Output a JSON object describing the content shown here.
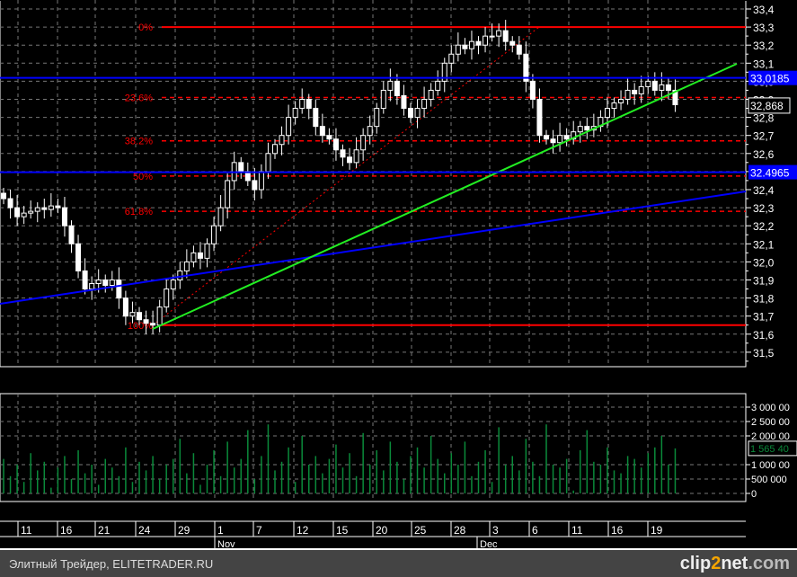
{
  "chart_data": {
    "type": "candlestick",
    "price_axis": {
      "min": 31.5,
      "max": 33.4,
      "ticks": [
        "33,4",
        "33,3",
        "33,2",
        "33,1",
        "33,0",
        "32,9",
        "32,8",
        "32,7",
        "32,6",
        "32,5",
        "32,4",
        "32,3",
        "32,2",
        "32,1",
        "32,0",
        "31,9",
        "31,8",
        "31,7",
        "31,6",
        "31,5"
      ],
      "tick_values": [
        33.4,
        33.3,
        33.2,
        33.1,
        33.0,
        32.9,
        32.8,
        32.7,
        32.6,
        32.5,
        32.4,
        32.3,
        32.2,
        32.1,
        32.0,
        31.9,
        31.8,
        31.7,
        31.6,
        31.5
      ]
    },
    "closes": [
      32.35,
      32.3,
      32.25,
      32.27,
      32.28,
      32.3,
      32.29,
      32.31,
      32.3,
      32.2,
      32.1,
      31.95,
      31.85,
      31.88,
      31.9,
      31.87,
      31.9,
      31.8,
      31.7,
      31.72,
      31.68,
      31.66,
      31.65,
      31.75,
      31.85,
      31.9,
      31.95,
      32.0,
      32.05,
      32.02,
      32.1,
      32.2,
      32.3,
      32.45,
      32.55,
      32.5,
      32.45,
      32.4,
      32.5,
      32.6,
      32.65,
      32.7,
      32.8,
      32.85,
      32.9,
      32.85,
      32.75,
      32.7,
      32.68,
      32.62,
      32.58,
      32.55,
      32.62,
      32.7,
      32.75,
      32.85,
      32.95,
      33.0,
      32.92,
      32.85,
      32.8,
      32.85,
      32.9,
      32.95,
      33.0,
      33.1,
      33.15,
      33.2,
      33.18,
      33.22,
      33.2,
      33.25,
      33.25,
      33.28,
      33.22,
      33.2,
      33.15,
      33.0,
      32.9,
      32.7,
      32.68,
      32.66,
      32.7,
      32.68,
      32.72,
      32.75,
      32.73,
      32.75,
      32.8,
      32.85,
      32.88,
      32.9,
      32.95,
      32.93,
      32.97,
      33.0,
      32.95,
      32.98,
      32.95,
      32.87
    ],
    "volumes": [
      1.2,
      0.6,
      1.0,
      0.4,
      1.4,
      0.8,
      1.1,
      0.2,
      0.9,
      1.3,
      0.5,
      1.5,
      0.7,
      1.0,
      0.3,
      1.2,
      0.9,
      0.6,
      1.6,
      0.4,
      1.1,
      0.8,
      1.3,
      0.5,
      1.0,
      1.2,
      1.9,
      0.7,
      1.4,
      0.3,
      1.0,
      1.5,
      0.6,
      1.8,
      0.9,
      1.2,
      2.2,
      0.5,
      1.3,
      2.4,
      0.8,
      1.1,
      1.6,
      0.4,
      2.0,
      1.0,
      1.3,
      0.7,
      1.2,
      1.7,
      0.9,
      1.4,
      0.6,
      2.1,
      1.0,
      1.5,
      0.8,
      1.8,
      1.1,
      0.5,
      1.3,
      1.6,
      0.9,
      2.0,
      1.2,
      0.7,
      1.4,
      1.0,
      1.8,
      0.6,
      1.1,
      1.5,
      0.4,
      2.3,
      1.0,
      1.3,
      0.8,
      1.9,
      1.1,
      0.6,
      2.4,
      1.0,
      0.9,
      1.2,
      0.1,
      1.5,
      2.2,
      1.1,
      1.0,
      1.6,
      0.8,
      0.7,
      1.3,
      1.2,
      0.9,
      1.4,
      1.6,
      2.0,
      1.0,
      1.565
    ],
    "volume_axis": {
      "min": 0,
      "max": 3000000,
      "ticks": [
        "3 000 00",
        "2 500 00",
        "2 000 00",
        "1 000 00",
        "500 000",
        "0"
      ],
      "tick_values": [
        3000000,
        2500000,
        2000000,
        1000000,
        500000,
        0
      ]
    },
    "current_volume_label": "1 565 40",
    "current_price_label": "32,868",
    "horizontal_levels": [
      {
        "label": "33,0185",
        "value": 33.0185,
        "color": "#0000ff"
      },
      {
        "label": "32.4965",
        "value": 32.4965,
        "color": "#0000ff"
      }
    ],
    "fibonacci": {
      "high": 33.3,
      "low": 31.65,
      "levels": [
        {
          "label": "0%",
          "value": 33.3
        },
        {
          "label": "23.6%",
          "value": 32.91
        },
        {
          "label": "38.2%",
          "value": 32.67
        },
        {
          "label": "50%",
          "value": 32.475
        },
        {
          "label": "61.8%",
          "value": 32.28
        },
        {
          "label": "100%",
          "value": 31.65
        }
      ],
      "color": "#ff0000"
    },
    "trendlines": [
      {
        "name": "green-trend",
        "color": "#22ee22",
        "from": [
          22,
          31.63
        ],
        "to": [
          108,
          33.09
        ]
      },
      {
        "name": "blue-trend",
        "color": "#0000ff",
        "from": [
          0,
          31.77
        ],
        "to": [
          110,
          32.39
        ]
      }
    ],
    "date_ticks": [
      "11",
      "16",
      "21",
      "24",
      "29",
      "1",
      "7",
      "12",
      "15",
      "20",
      "25",
      "28",
      "3",
      "6",
      "11",
      "16",
      "19"
    ],
    "months": [
      "Nov",
      "Dec"
    ]
  },
  "footer": {
    "source": "Элитный Трейдер, ELITETRADER.RU",
    "logo": "clip2net.com"
  }
}
